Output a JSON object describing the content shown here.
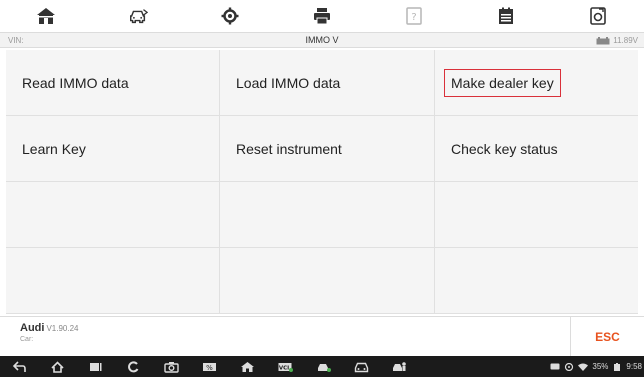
{
  "toolbar": {
    "icons": [
      "home-icon",
      "vehicle-swap-icon",
      "settings-icon",
      "print-icon",
      "help-icon",
      "data-log-icon",
      "screenshot-icon"
    ]
  },
  "infobar": {
    "vin_label": "VIN:",
    "title": "IMMO V",
    "voltage": "11.89V"
  },
  "menu": {
    "items": [
      {
        "label": "Read IMMO data"
      },
      {
        "label": "Load IMMO data"
      },
      {
        "label": "Make dealer key"
      },
      {
        "label": "Learn Key"
      },
      {
        "label": "Reset instrument"
      },
      {
        "label": "Check key status"
      }
    ],
    "selected_index": 2
  },
  "footer": {
    "make": "Audi",
    "version": "V1.90.24",
    "car_label": "Car:",
    "esc_label": "ESC"
  },
  "colors": {
    "accent": "#e8531f",
    "highlight_border": "#d9303a",
    "nav_bg": "#1b1b1b"
  },
  "statusbar": {
    "battery": "35%",
    "time": "9:58"
  }
}
